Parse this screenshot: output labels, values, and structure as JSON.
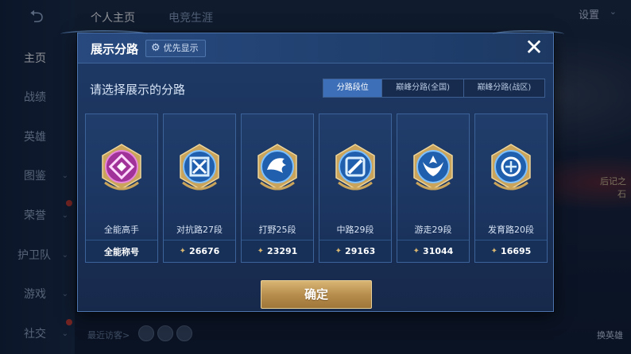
{
  "background": {
    "nav": [
      "主页",
      "战绩",
      "英雄",
      "图鉴",
      "荣誉",
      "护卫队",
      "游戏",
      "社交"
    ],
    "top_tabs": [
      "个人主页",
      "电竞生涯"
    ],
    "settings": "设置",
    "recent_visitors": "最近访客>",
    "switch_hero": "换英雄",
    "side_label": "后记之石"
  },
  "modal": {
    "title": "展示分路",
    "priority_chip": "优先显示",
    "prompt": "请选择展示的分路",
    "tabs": [
      {
        "label": "分路段位",
        "active": true
      },
      {
        "label": "巅峰分路(全国)",
        "active": false
      },
      {
        "label": "巅峰分路(战区)",
        "active": false
      }
    ],
    "cards": [
      {
        "label": "全能高手",
        "footer": "全能称号",
        "score": null,
        "badge": "all-round-badge-icon",
        "color": "#b03ca6"
      },
      {
        "label": "对抗路27段",
        "footer": null,
        "score": "26676",
        "badge": "clash-lane-badge-icon",
        "color": "#2e78d2"
      },
      {
        "label": "打野25段",
        "footer": null,
        "score": "23291",
        "badge": "jungle-badge-icon",
        "color": "#2e78d2"
      },
      {
        "label": "中路29段",
        "footer": null,
        "score": "29163",
        "badge": "mid-lane-badge-icon",
        "color": "#2e78d2"
      },
      {
        "label": "游走29段",
        "footer": null,
        "score": "31044",
        "badge": "roam-badge-icon",
        "color": "#2e78d2"
      },
      {
        "label": "发育路20段",
        "footer": null,
        "score": "16695",
        "badge": "farm-lane-badge-icon",
        "color": "#2e78d2"
      }
    ],
    "confirm": "确定"
  },
  "colors": {
    "accent_gold": "#d8b574",
    "tab_active": "#3c6fb8",
    "modal_bg": "#1e3a66"
  }
}
